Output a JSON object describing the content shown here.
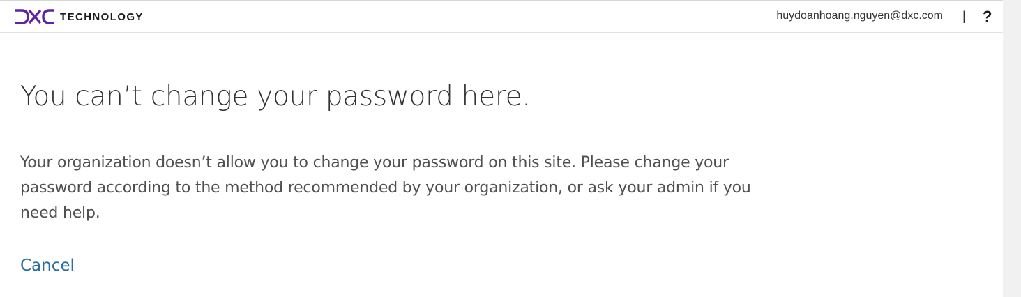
{
  "header": {
    "brand_text": "TECHNOLOGY",
    "logo_icon": "dxc-logo-icon",
    "user_email": "huydoanhoang.nguyen@dxc.com",
    "divider": "|",
    "help_label": "?"
  },
  "main": {
    "title": "You can’t change your password here.",
    "message": "Your organization doesn’t allow you to change your password on this site. Please change your password according to the method recommended by your organization, or ask your admin if you need help.",
    "cancel_label": "Cancel"
  },
  "colors": {
    "brand_purple": "#5f249f",
    "link_blue": "#2b6ea0",
    "title_text": "#333333",
    "body_text": "#505050"
  }
}
